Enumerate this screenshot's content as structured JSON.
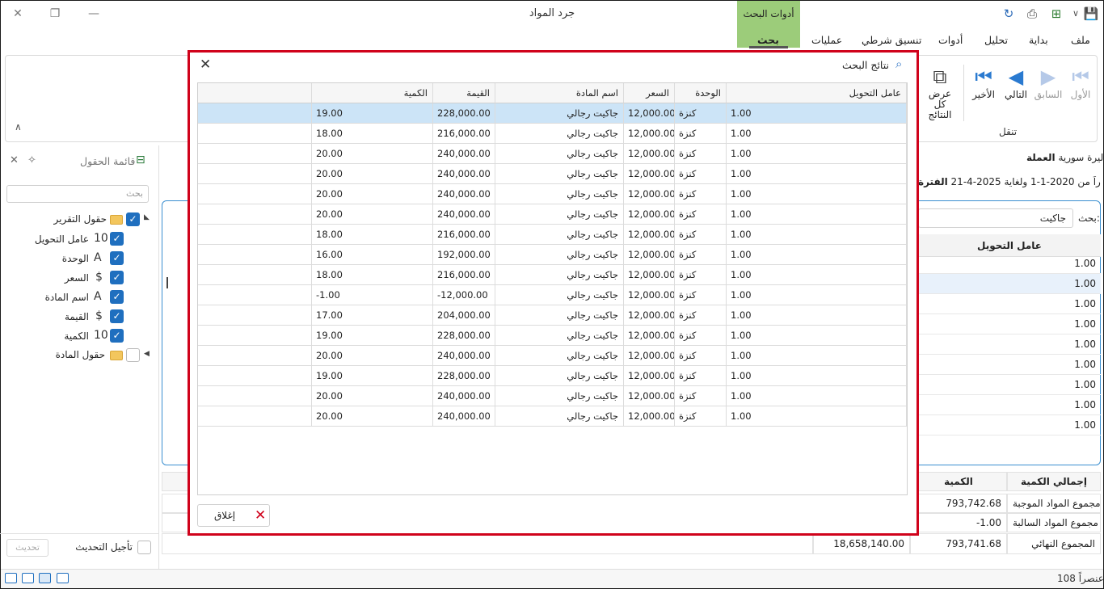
{
  "window": {
    "title": "جرد المواد",
    "context_tab_title": "أدوات البحث"
  },
  "ribbon_tabs": [
    "ملف",
    "بداية",
    "تحليل",
    "أدوات",
    "تنسيق شرطي",
    "عمليات",
    "بحث"
  ],
  "nav_group": {
    "label": "تنقل",
    "buttons": [
      "الأول",
      "السابق",
      "التالي",
      "الأخير",
      "عرض كل النتائج"
    ]
  },
  "field_list": {
    "title": "قائمة الحقول",
    "search_placeholder": "بحث",
    "report_fields_label": "حقول التقرير",
    "fields": [
      {
        "label": "عامل التحويل",
        "icon": "10"
      },
      {
        "label": "الوحدة",
        "icon": "A"
      },
      {
        "label": "السعر",
        "icon": "$"
      },
      {
        "label": "اسم المادة",
        "icon": "A"
      },
      {
        "label": "القيمة",
        "icon": "$"
      },
      {
        "label": "الكمية",
        "icon": "10"
      }
    ],
    "material_fields_label": "حقول المادة",
    "defer_update_label": "تأجيل التحديث",
    "update_button": "تحديث"
  },
  "report": {
    "currency_label": "العملة:",
    "currency_value": "ليرة سورية",
    "period_label": "الفترة :",
    "period_value": "اعتباراً من 2020-1-1 ولغاية 2025-4-21",
    "search_label": "بحث:",
    "search_value": "جاكيت",
    "column_header": "عامل التحويل",
    "column_values": [
      "1.00",
      "1.00",
      "1.00",
      "1.00",
      "1.00",
      "1.00",
      "1.00",
      "1.00",
      "1.00"
    ],
    "summary": {
      "header_total": "إجمالي الكمية",
      "header_qty": "الكمية",
      "rows": [
        {
          "label": "مجموع المواد الموجبة",
          "qty": "793,742.68",
          "value": ""
        },
        {
          "label": "مجموع المواد السالبة",
          "qty": "-1.00",
          "value": ""
        },
        {
          "label": "المجموع النهائي",
          "qty": "793,741.68",
          "value": "18,658,140.00"
        }
      ]
    }
  },
  "status": {
    "items_count": "108 عنصراً"
  },
  "dialog": {
    "title": "نتائج البحث",
    "close_button": "إغلاق",
    "columns": [
      "عامل التحويل",
      "الوحدة",
      "السعر",
      "اسم المادة",
      "القيمة",
      "الكمية"
    ],
    "rows": [
      [
        "1.00",
        "كنزة",
        "12,000.00",
        "جاكيت رجالي",
        "228,000.00",
        "19.00"
      ],
      [
        "1.00",
        "كنزة",
        "12,000.00",
        "جاكيت رجالي",
        "216,000.00",
        "18.00"
      ],
      [
        "1.00",
        "كنزة",
        "12,000.00",
        "جاكيت رجالي",
        "240,000.00",
        "20.00"
      ],
      [
        "1.00",
        "كنزة",
        "12,000.00",
        "جاكيت رجالي",
        "240,000.00",
        "20.00"
      ],
      [
        "1.00",
        "كنزة",
        "12,000.00",
        "جاكيت رجالي",
        "240,000.00",
        "20.00"
      ],
      [
        "1.00",
        "كنزة",
        "12,000.00",
        "جاكيت رجالي",
        "240,000.00",
        "20.00"
      ],
      [
        "1.00",
        "كنزة",
        "12,000.00",
        "جاكيت رجالي",
        "216,000.00",
        "18.00"
      ],
      [
        "1.00",
        "كنزة",
        "12,000.00",
        "جاكيت رجالي",
        "192,000.00",
        "16.00"
      ],
      [
        "1.00",
        "كنزة",
        "12,000.00",
        "جاكيت رجالي",
        "216,000.00",
        "18.00"
      ],
      [
        "1.00",
        "كنزة",
        "12,000.00",
        "جاكيت رجالي",
        "-12,000.00",
        "-1.00"
      ],
      [
        "1.00",
        "كنزة",
        "12,000.00",
        "جاكيت رجالي",
        "204,000.00",
        "17.00"
      ],
      [
        "1.00",
        "كنزة",
        "12,000.00",
        "جاكيت رجالي",
        "228,000.00",
        "19.00"
      ],
      [
        "1.00",
        "كنزة",
        "12,000.00",
        "جاكيت رجالي",
        "240,000.00",
        "20.00"
      ],
      [
        "1.00",
        "كنزة",
        "12,000.00",
        "جاكيت رجالي",
        "228,000.00",
        "19.00"
      ],
      [
        "1.00",
        "كنزة",
        "12,000.00",
        "جاكيت رجالي",
        "240,000.00",
        "20.00"
      ],
      [
        "1.00",
        "كنزة",
        "12,000.00",
        "جاكيت رجالي",
        "240,000.00",
        "20.00"
      ]
    ]
  },
  "colors": {
    "context_tab": "#9ccc7a",
    "highlight_border": "#d0021b",
    "selection": "#cce4f7",
    "checkbox": "#1f6fbf"
  }
}
